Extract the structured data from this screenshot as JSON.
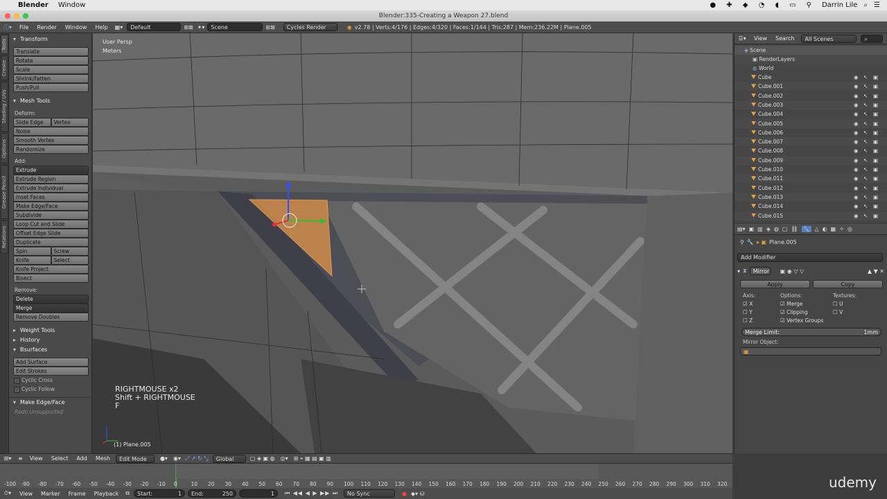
{
  "macbar": {
    "app": "Blender",
    "menu": "Window",
    "user": "Darrin Lile"
  },
  "title": "Blender:335-Creating a Weapon 27.blend",
  "info": {
    "menus": [
      "File",
      "Render",
      "Window",
      "Help"
    ],
    "layout": "Default",
    "scene": "Scene",
    "engine": "Cycles Render",
    "stats": "v2.78 | Verts:4/176 | Edges:4/320 | Faces:1/144 | Tris:287 | Mem:236.22M | Plane.005"
  },
  "tabs": [
    "Tools",
    "Create",
    "Shading / UVs",
    "Options",
    "Grease Pencil",
    "Relations"
  ],
  "toolshelf": {
    "transform": "Transform",
    "translate": "Translate",
    "rotate": "Rotate",
    "scale": "Scale",
    "shrink": "Shrink/Fatten",
    "push": "Push/Pull",
    "mesh_tools": "Mesh Tools",
    "deform": "Deform:",
    "slide_edge": "Slide Edge",
    "vertex": "Vertex",
    "noise": "Noise",
    "smooth_vertex": "Smooth Vertex",
    "randomize": "Randomize",
    "add": "Add:",
    "extrude": "Extrude",
    "extrude_region": "Extrude Region",
    "extrude_individual": "Extrude Individual",
    "inset": "Inset Faces",
    "make_edge": "Make Edge/Face",
    "subdivide": "Subdivide",
    "loop_cut": "Loop Cut and Slide",
    "offset_edge": "Offset Edge Slide",
    "duplicate": "Duplicate",
    "spin": "Spin",
    "screw": "Screw",
    "knife": "Knife",
    "select": "Select",
    "knife_project": "Knife Project",
    "bisect": "Bisect",
    "remove": "Remove:",
    "delete": "Delete",
    "merge": "Merge",
    "remove_doubles": "Remove Doubles",
    "weight_tools": "Weight Tools",
    "history": "History",
    "bsurfaces": "Bsurfaces",
    "add_surface": "Add Surface",
    "edit_strokes": "Edit Strokes",
    "cyclic_cross": "Cyclic Cross",
    "cyclic_follow": "Cyclic Follow",
    "make_edge_face": "Make Edge/Face",
    "redo": "Redo Unsupported"
  },
  "viewport": {
    "view": "User Persp",
    "units": "Meters",
    "keys": [
      "RIGHTMOUSE x2",
      "Shift + RIGHTMOUSE",
      "F"
    ],
    "object": "(1) Plane.005"
  },
  "outliner": {
    "menus": [
      "View",
      "Search"
    ],
    "scope": "All Scenes",
    "scene": "Scene",
    "renderlayers": "RenderLayers",
    "world": "World",
    "objects": [
      "Cube",
      "Cube.001",
      "Cube.002",
      "Cube.003",
      "Cube.004",
      "Cube.005",
      "Cube.006",
      "Cube.007",
      "Cube.008",
      "Cube.009",
      "Cube.010",
      "Cube.011",
      "Cube.012",
      "Cube.013",
      "Cube.014",
      "Cube.015"
    ]
  },
  "props": {
    "object": "Plane.005",
    "add_modifier": "Add Modifier",
    "modifier": "Mirror",
    "apply": "Apply",
    "copy": "Copy",
    "axis": "Axis:",
    "options": "Options:",
    "textures": "Textures:",
    "x": "X",
    "y": "Y",
    "z": "Z",
    "merge": "Merge",
    "clipping": "Clipping",
    "vgroups": "Vertex Groups",
    "u": "U",
    "v": "V",
    "merge_limit": "Merge Limit:",
    "merge_limit_val": "1mm",
    "mirror_object": "Mirror Object:"
  },
  "vpheader": {
    "menus": [
      "View",
      "Select",
      "Add",
      "Mesh"
    ],
    "mode": "Edit Mode",
    "orient": "Global"
  },
  "timeline": {
    "ticks": [
      "-100",
      "-90",
      "-80",
      "-70",
      "-60",
      "-50",
      "-40",
      "-30",
      "-20",
      "-10",
      "0",
      "10",
      "20",
      "30",
      "40",
      "50",
      "60",
      "70",
      "80",
      "90",
      "100",
      "110",
      "120",
      "130",
      "140",
      "150",
      "160",
      "170",
      "180",
      "190",
      "200",
      "210",
      "220",
      "230",
      "240",
      "250",
      "260",
      "270",
      "280",
      "290",
      "300",
      "310",
      "320"
    ],
    "menus": [
      "View",
      "Marker",
      "Frame",
      "Playback"
    ],
    "start": "Start:",
    "start_val": "1",
    "end": "End:",
    "end_val": "250",
    "current": "1",
    "sync": "No Sync"
  },
  "watermark": "udemy"
}
